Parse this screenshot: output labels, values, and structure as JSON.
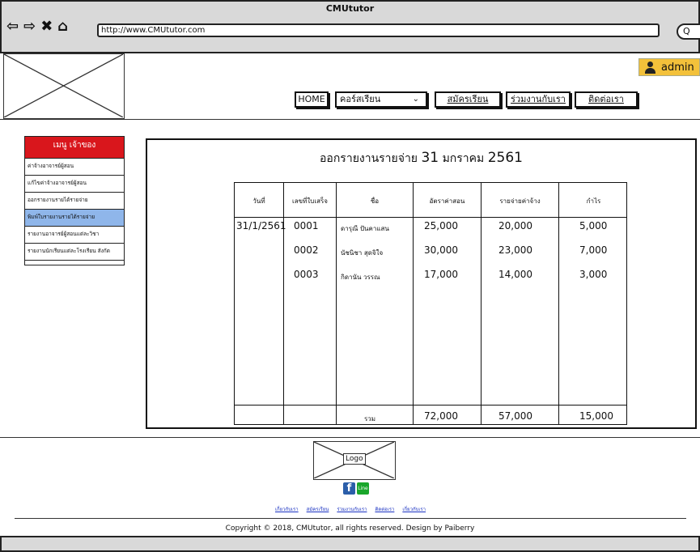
{
  "browser": {
    "title": "CMUtutor",
    "url": "http://www.CMUtutor.com",
    "search_glyph": "Q"
  },
  "header": {
    "admin_label": "admin",
    "nav": {
      "home": "HOME",
      "courses": "คอร์สเรียน",
      "register": "สมัครเรียน",
      "partner": "ร่วมงานกับเรา",
      "contact": "ติดต่อเรา"
    }
  },
  "sidebar": {
    "title": "เมนู เจ้าของ",
    "items": [
      {
        "label": "ค่าจ้างอาจารย์ผู้สอน"
      },
      {
        "label": "แก้ไขค่าจ้างอาจารย์ผู้สอน"
      },
      {
        "label": "ออกรายงานรายได้รายจ่าย"
      },
      {
        "label": "พิมพ์ใบรายงานรายได้รายจ่าย"
      },
      {
        "label": "รายงานอาจารย์ผู้สอนแต่ละวิชา"
      },
      {
        "label": "รายงานนักเรียนแต่ละโรงเรียน สังกัด"
      }
    ]
  },
  "report": {
    "title_prefix": "ออกรายงานรายจ่าย",
    "day": "31",
    "month": "มกราคม",
    "year": "2561",
    "headers": [
      "วันที่",
      "เลขที่ใบเสร็จ",
      "ชื่อ",
      "อัตราค่าสอน",
      "รายจ่ายค่าจ้าง",
      "กำไร"
    ],
    "rows": [
      {
        "date": "31/1/2561",
        "receipt": "0001",
        "name": "ดารุณี ปันคาแสน",
        "rate": "25,000",
        "wage": "20,000",
        "profit": "5,000"
      },
      {
        "date": "",
        "receipt": "0002",
        "name": "นัชนิชา สุดจิใจ",
        "rate": "30,000",
        "wage": "23,000",
        "profit": "7,000"
      },
      {
        "date": "",
        "receipt": "0003",
        "name": "กิดานัน วรรณ",
        "rate": "17,000",
        "wage": "14,000",
        "profit": "3,000"
      }
    ],
    "total_label": "รวม",
    "total_rate": "72,000",
    "total_wage": "57,000",
    "total_profit": "15,000"
  },
  "footer": {
    "logo_label": "Logo",
    "fb_glyph": "f",
    "line_label": "Line",
    "links": [
      "เกี่ยวกับเรา",
      "สมัครเรียน",
      "ร่วมงานกับเรา",
      "ติดต่อเรา",
      "เกี่ยวกับเรา"
    ],
    "copyright": "Copyright © 2018, CMUtutor, all rights reserved. Design by Paiberry"
  },
  "icons": [
    "back-arrow-icon",
    "forward-arrow-icon",
    "close-icon",
    "home-icon",
    "search-icon",
    "user-icon",
    "facebook-icon",
    "line-icon",
    "chevron-down-icon"
  ],
  "colors": {
    "admin_bg": "#f3c13a",
    "menu_header": "#d9161c",
    "menu_active": "#8fb6ea",
    "link": "#1a32c2"
  }
}
